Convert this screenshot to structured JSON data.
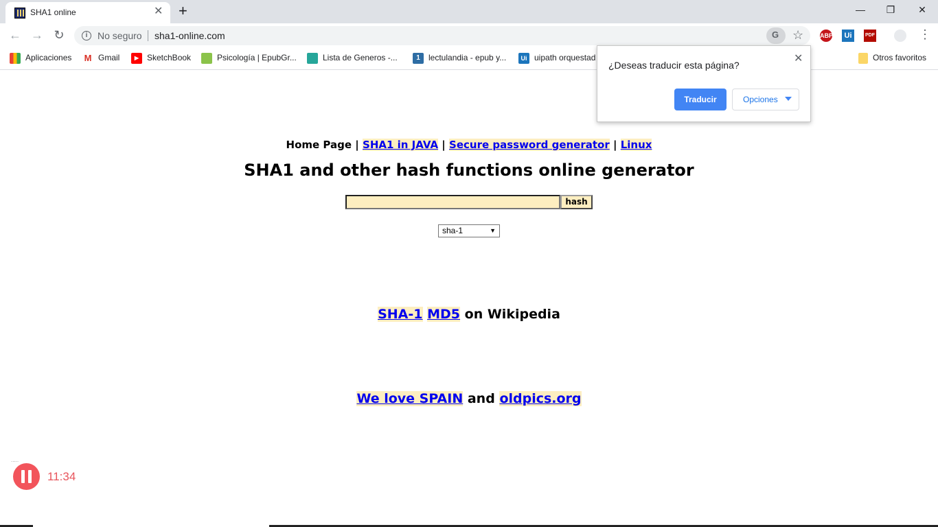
{
  "tab": {
    "title": "SHA1 online",
    "close": "✕",
    "new_tab": "+"
  },
  "window": {
    "minimize": "—",
    "restore": "❐",
    "close": "✕"
  },
  "toolbar": {
    "back": "←",
    "forward": "→",
    "reload": "↻",
    "security_label": "No seguro",
    "url": "sha1-online.com",
    "star": "☆",
    "menu": "⋮",
    "extensions": [
      "ABP",
      "Ui",
      "PDF"
    ]
  },
  "bookmarks": [
    {
      "label": "Aplicaciones",
      "icon": "apps-grid-icon",
      "color": "#e94235"
    },
    {
      "label": "Gmail",
      "icon": "gmail-icon",
      "color": "#d93025"
    },
    {
      "label": "SketchBook",
      "icon": "youtube-icon",
      "color": "#ff0000"
    },
    {
      "label": "Psicología | EpubGr...",
      "icon": "epub-icon",
      "color": "#8bc34a"
    },
    {
      "label": "Lista de Generos -...",
      "icon": "book-icon",
      "color": "#26a69a"
    },
    {
      "label": "lectulandia - epub y...",
      "icon": "lectulandia-icon",
      "color": "#2e6da4"
    },
    {
      "label": "uipath orquestad",
      "icon": "uipath-icon",
      "color": "#1c75bc"
    }
  ],
  "other_bookmarks": "Otros favoritos",
  "translate_popup": {
    "question": "¿Deseas traducir esta página?",
    "translate_button": "Traducir",
    "options_button": "Opciones",
    "close": "✕"
  },
  "page": {
    "nav": {
      "home": "Home Page",
      "sep": "|",
      "links": [
        "SHA1 in JAVA",
        "Secure password generator",
        "Linux"
      ]
    },
    "heading": "SHA1 and other hash functions online generator",
    "hash_input_value": "",
    "hash_button": "hash",
    "algorithm_selected": "sha-1",
    "wiki_links": [
      "SHA-1",
      "MD5"
    ],
    "wiki_suffix": "on Wikipedia",
    "love_link": "We love SPAIN",
    "love_and": "and",
    "love_link2": "oldpics.org"
  },
  "recorder": {
    "time": "11:34"
  },
  "colors": {
    "link": "#0000ee",
    "highlight": "#fdeec0",
    "primary_button": "#4285f4",
    "recorder": "#f2545b"
  }
}
